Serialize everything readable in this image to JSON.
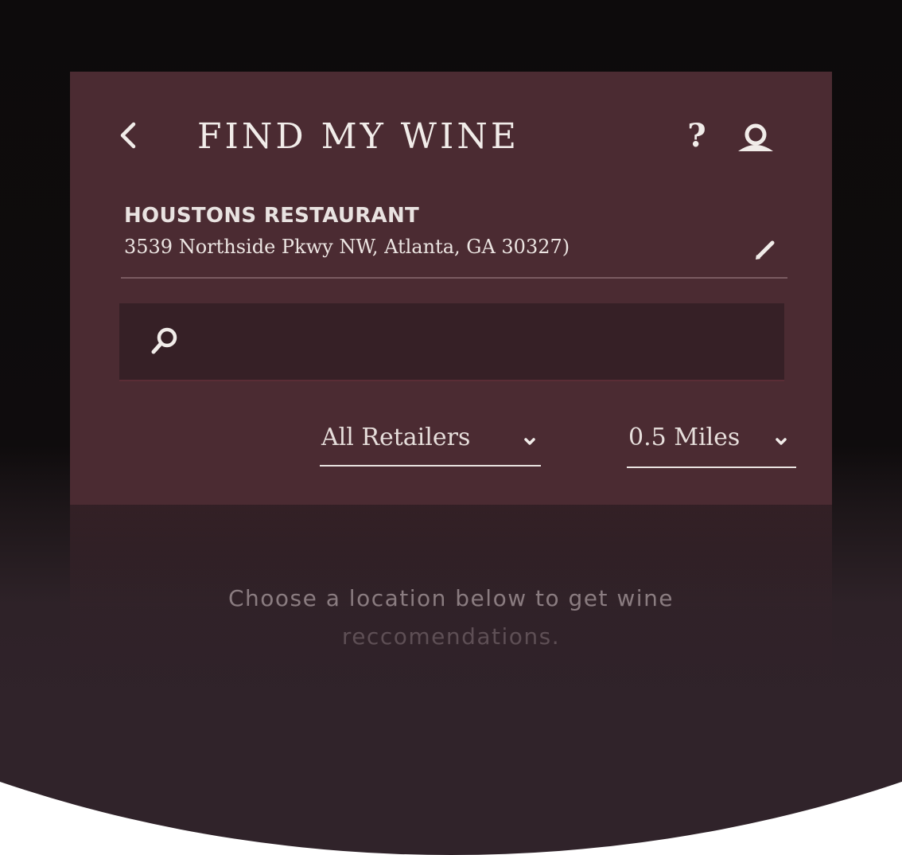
{
  "colors": {
    "panel_background": "#4b2b32",
    "search_background": "#362026",
    "page_background": "#30232a",
    "text_primary": "#f1ece9"
  },
  "header": {
    "back_icon": "chevron-left-icon",
    "title": "FIND MY WINE",
    "help_label": "?",
    "profile_icon": "user-icon"
  },
  "location": {
    "name": "HOUSTONS RESTAURANT",
    "address": "3539 Northside Pkwy NW, Atlanta, GA 30327)",
    "edit_icon": "pencil-icon"
  },
  "search": {
    "icon": "search-icon",
    "value": "",
    "placeholder": ""
  },
  "filters": {
    "retailer": {
      "selected": "All Retailers",
      "icon": "chevron-down-icon"
    },
    "distance": {
      "selected": "0.5 Miles",
      "icon": "chevron-down-icon"
    }
  },
  "empty_state": {
    "line1": "Choose a location below to get wine",
    "line2": "reccomendations."
  }
}
